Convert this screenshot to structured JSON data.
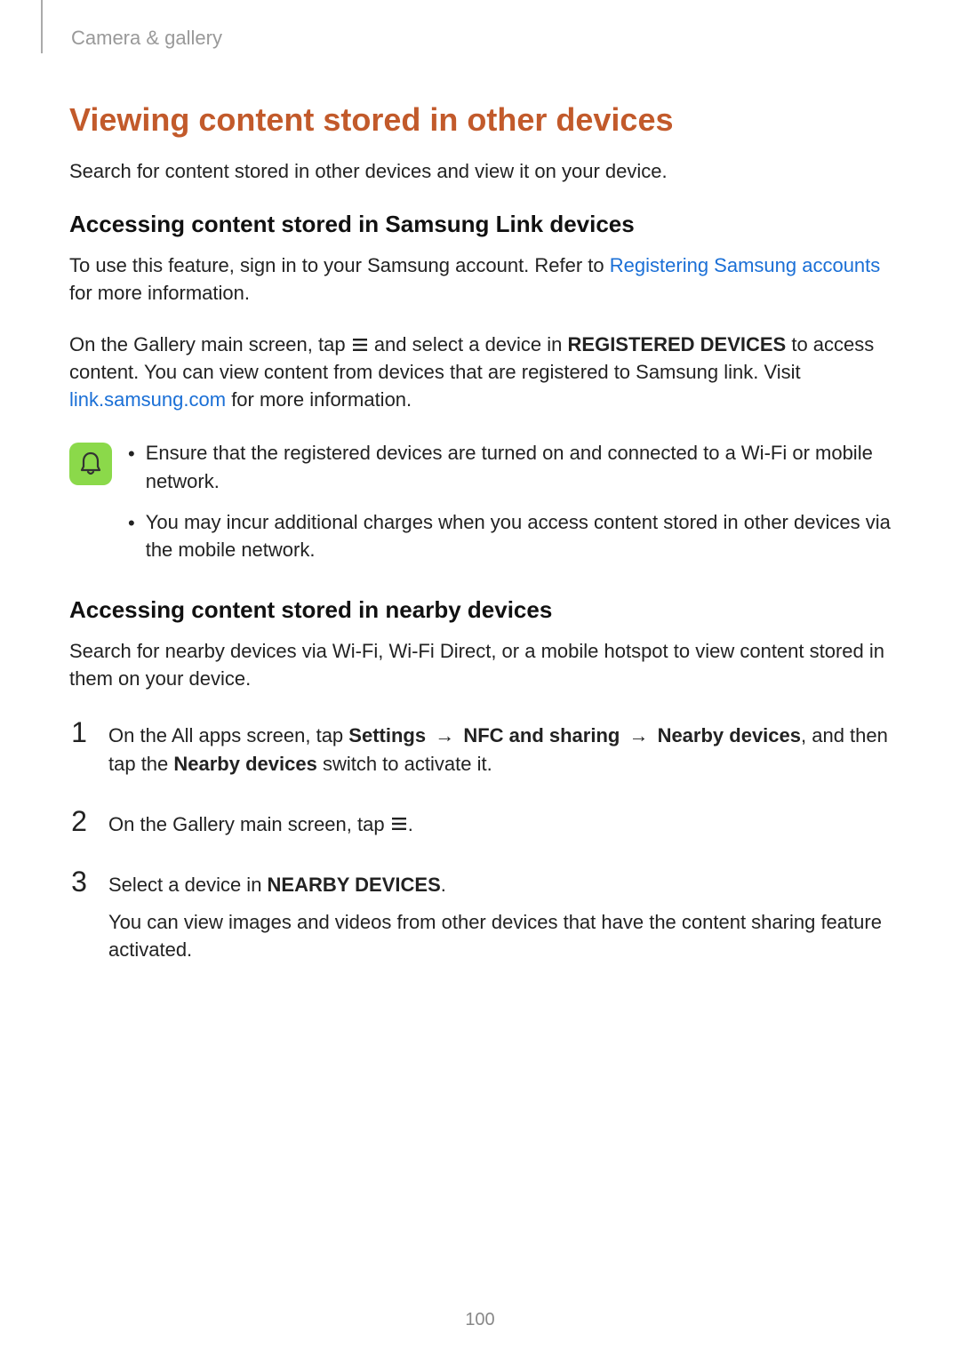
{
  "breadcrumb": "Camera & gallery",
  "h1": "Viewing content stored in other devices",
  "intro": "Search for content stored in other devices and view it on your device.",
  "section1": {
    "heading": "Accessing content stored in Samsung Link devices",
    "p1a": "To use this feature, sign in to your Samsung account. Refer to ",
    "p1link": "Registering Samsung accounts",
    "p1b": " for more information.",
    "p2a": "On the Gallery main screen, tap ",
    "p2b": " and select a device in ",
    "p2bold": "REGISTERED DEVICES",
    "p2c": " to access content. You can view content from devices that are registered to Samsung link. Visit ",
    "p2link": "link.samsung.com",
    "p2d": " for more information.",
    "note1": "Ensure that the registered devices are turned on and connected to a Wi-Fi or mobile network.",
    "note2": "You may incur additional charges when you access content stored in other devices via the mobile network."
  },
  "section2": {
    "heading": "Accessing content stored in nearby devices",
    "intro": "Search for nearby devices via Wi-Fi, Wi-Fi Direct, or a mobile hotspot to view content stored in them on your device.",
    "step1": {
      "num": "1",
      "a": "On the All apps screen, tap ",
      "settings": "Settings",
      "arrow1": " → ",
      "nfc": "NFC and sharing",
      "arrow2": " → ",
      "nearby": "Nearby devices",
      "b": ", and then tap the ",
      "nearby_switch": "Nearby devices",
      "c": " switch to activate it."
    },
    "step2": {
      "num": "2",
      "a": "On the Gallery main screen, tap ",
      "b": "."
    },
    "step3": {
      "num": "3",
      "a": "Select a device in ",
      "bold": "NEARBY DEVICES",
      "b": ".",
      "p2": "You can view images and videos from other devices that have the content sharing feature activated."
    }
  },
  "page_number": "100"
}
